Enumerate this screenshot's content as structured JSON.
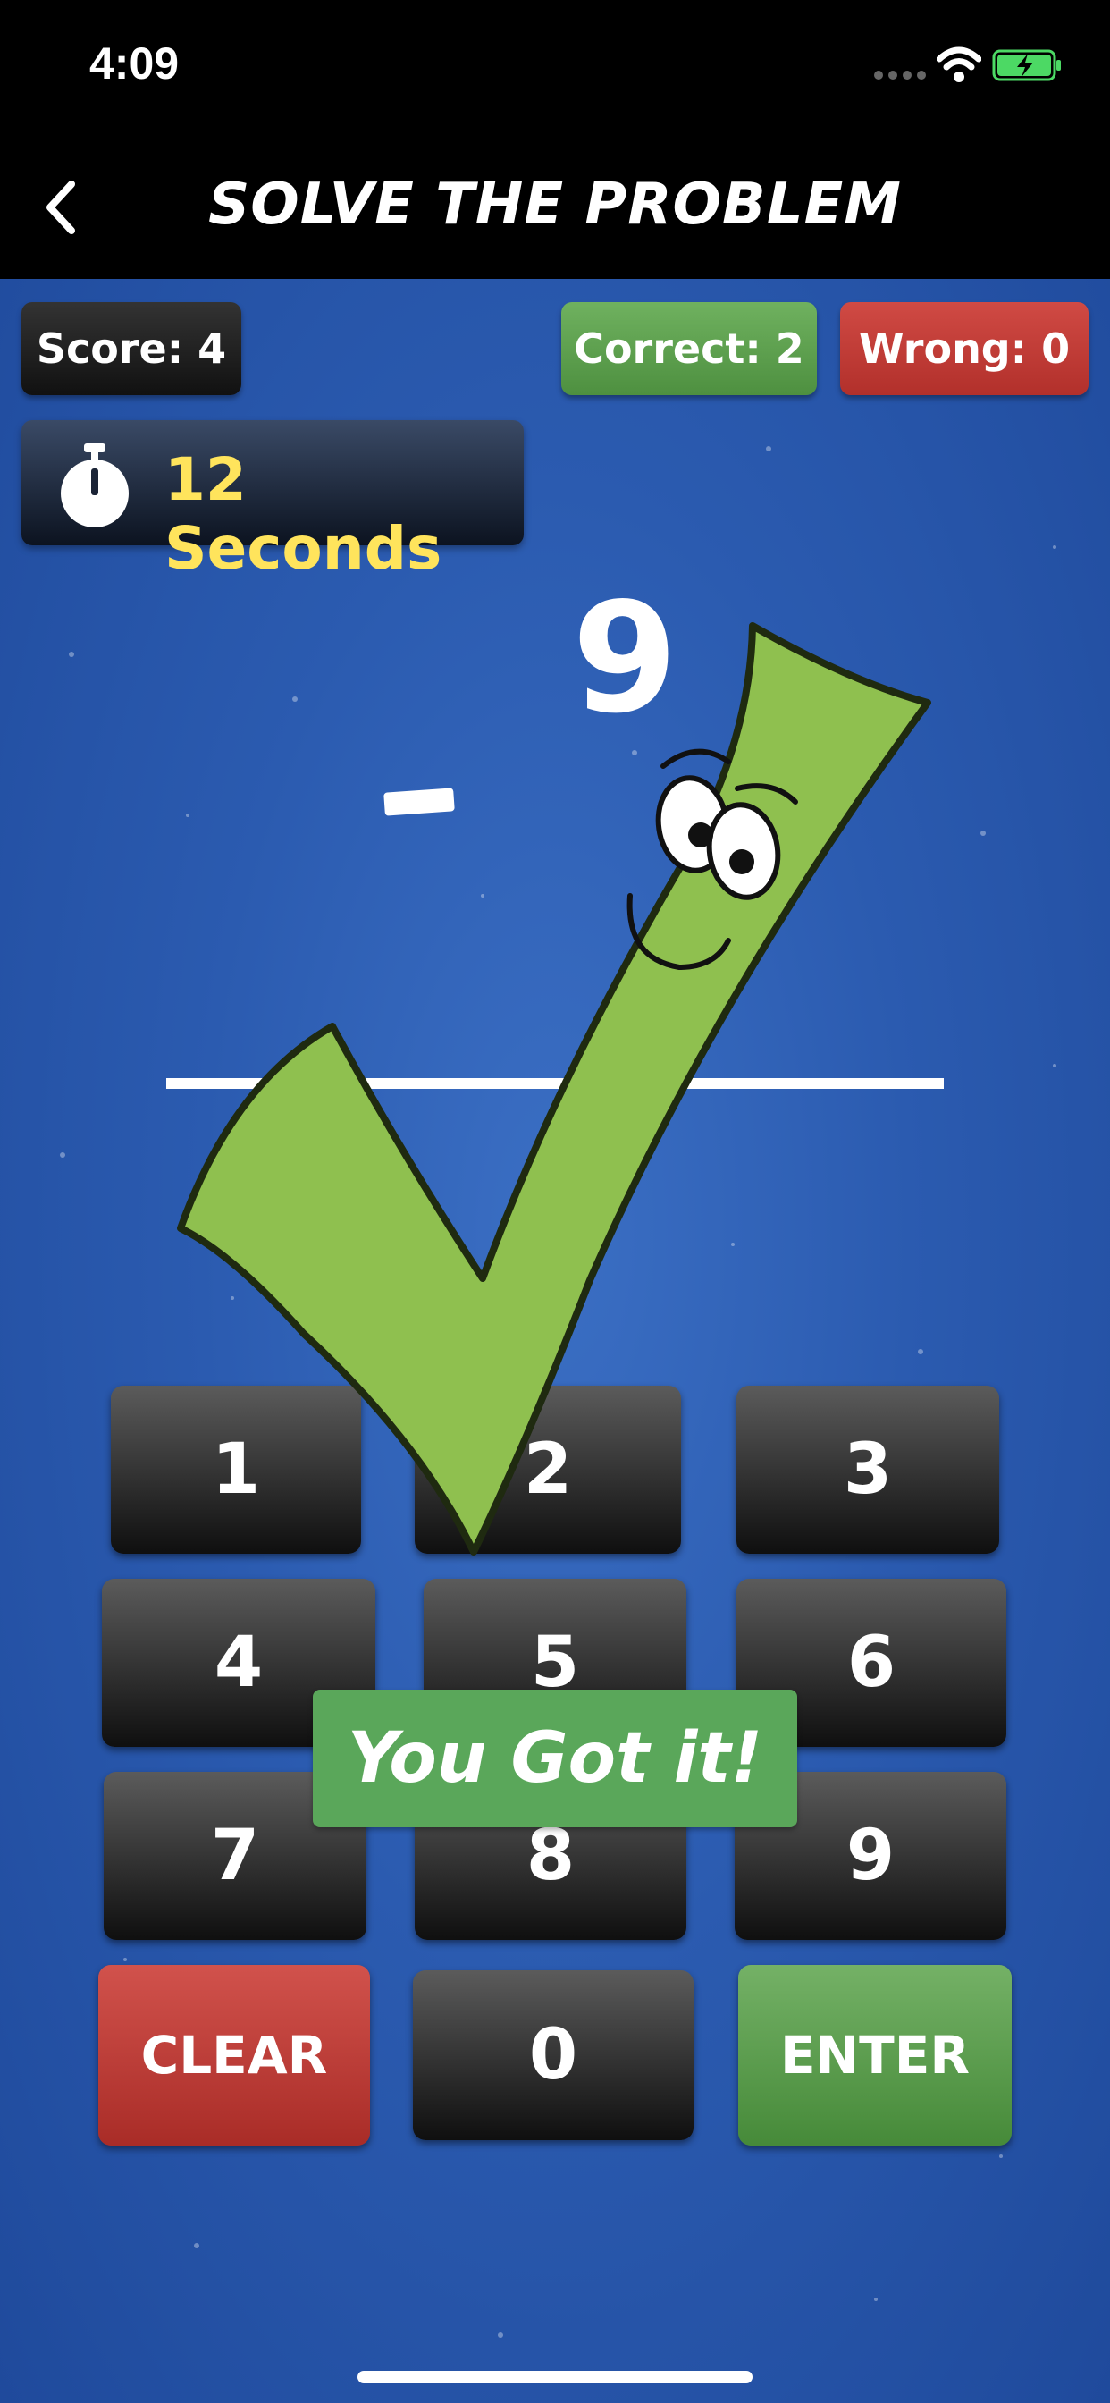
{
  "status_bar": {
    "time": "4:09"
  },
  "nav": {
    "title": "SOLVE THE PROBLEM"
  },
  "stats": {
    "score": "Score: 4",
    "correct": "Correct: 2",
    "wrong": "Wrong: 0"
  },
  "timer": {
    "text": "12 Seconds"
  },
  "problem": {
    "top_number": "9"
  },
  "keypad": {
    "k1": "1",
    "k2": "2",
    "k3": "3",
    "k4": "4",
    "k5": "5",
    "k6": "6",
    "k7": "7",
    "k8": "8",
    "k9": "9",
    "clear": "CLEAR",
    "k0": "0",
    "enter": "ENTER"
  },
  "feedback": {
    "message": "You Got it!"
  },
  "colors": {
    "background": "#2b5bb0",
    "correct": "#5aa75a",
    "wrong": "#c23a35",
    "timer_text": "#ffe45c",
    "checkmark": "#8fc04f"
  },
  "icons": {
    "back": "chevron-left-icon",
    "timer": "stopwatch-icon",
    "feedback_mascot": "smiling-checkmark-icon"
  }
}
